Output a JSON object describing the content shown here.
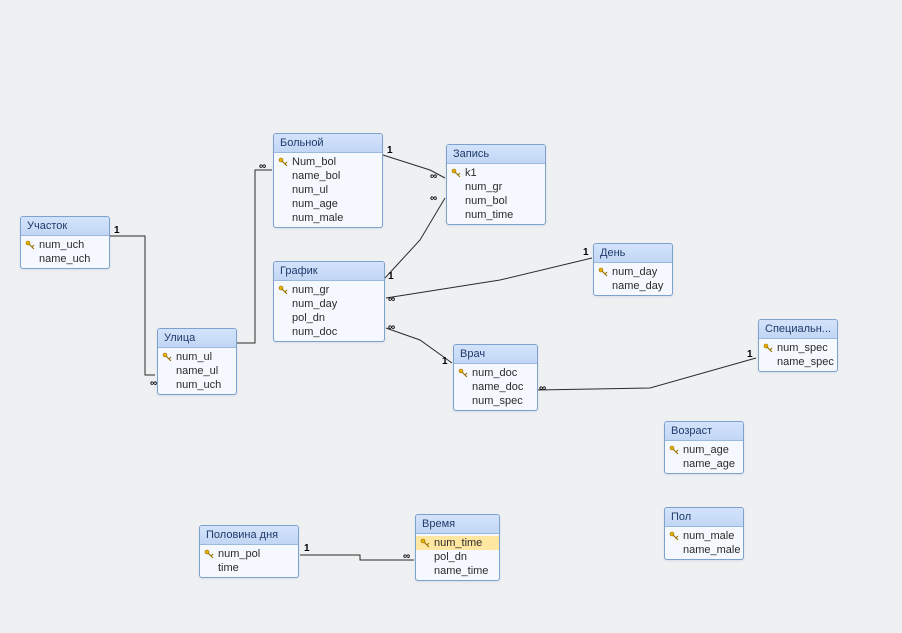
{
  "tables": {
    "uchastok": {
      "title": "Участок",
      "fields": [
        {
          "name": "num_uch",
          "pk": true
        },
        {
          "name": "name_uch",
          "pk": false
        }
      ]
    },
    "ulitsa": {
      "title": "Улица",
      "fields": [
        {
          "name": "num_ul",
          "pk": true
        },
        {
          "name": "name_ul",
          "pk": false
        },
        {
          "name": "num_uch",
          "pk": false
        }
      ]
    },
    "bolnoy": {
      "title": "Больной",
      "fields": [
        {
          "name": "Num_bol",
          "pk": true
        },
        {
          "name": "name_bol",
          "pk": false
        },
        {
          "name": "num_ul",
          "pk": false
        },
        {
          "name": "num_age",
          "pk": false
        },
        {
          "name": "num_male",
          "pk": false
        }
      ]
    },
    "zapis": {
      "title": "Запись",
      "fields": [
        {
          "name": "k1",
          "pk": true
        },
        {
          "name": "num_gr",
          "pk": false
        },
        {
          "name": "num_bol",
          "pk": false
        },
        {
          "name": "num_time",
          "pk": false
        }
      ]
    },
    "grafik": {
      "title": "График",
      "fields": [
        {
          "name": "num_gr",
          "pk": true
        },
        {
          "name": "num_day",
          "pk": false
        },
        {
          "name": "pol_dn",
          "pk": false
        },
        {
          "name": "num_doc",
          "pk": false
        }
      ]
    },
    "den": {
      "title": "День",
      "fields": [
        {
          "name": "num_day",
          "pk": true
        },
        {
          "name": "name_day",
          "pk": false
        }
      ]
    },
    "vrach": {
      "title": "Врач",
      "fields": [
        {
          "name": "num_doc",
          "pk": true
        },
        {
          "name": "name_doc",
          "pk": false
        },
        {
          "name": "num_spec",
          "pk": false
        }
      ]
    },
    "spec": {
      "title": "Специальн...",
      "fields": [
        {
          "name": "num_spec",
          "pk": true
        },
        {
          "name": "name_spec",
          "pk": false
        }
      ]
    },
    "vozrast": {
      "title": "Возраст",
      "fields": [
        {
          "name": "num_age",
          "pk": true
        },
        {
          "name": "name_age",
          "pk": false
        }
      ]
    },
    "pol": {
      "title": "Пол",
      "fields": [
        {
          "name": "num_male",
          "pk": true
        },
        {
          "name": "name_male",
          "pk": false
        }
      ]
    },
    "polovina": {
      "title": "Половина дня",
      "fields": [
        {
          "name": "num_pol",
          "pk": true
        },
        {
          "name": "time",
          "pk": false
        }
      ]
    },
    "vremya": {
      "title": "Время",
      "fields": [
        {
          "name": "num_time",
          "pk": true,
          "highlight": true
        },
        {
          "name": "pol_dn",
          "pk": false
        },
        {
          "name": "name_time",
          "pk": false
        }
      ]
    }
  },
  "relations": [
    {
      "from": "uchastok",
      "to": "ulitsa",
      "fromCard": "1",
      "toCard": "∞"
    },
    {
      "from": "ulitsa",
      "to": "bolnoy",
      "fromCard": "1",
      "toCard": "∞"
    },
    {
      "from": "bolnoy",
      "to": "zapis",
      "fromCard": "1",
      "toCard": "∞"
    },
    {
      "from": "grafik",
      "to": "zapis",
      "fromCard": "1",
      "toCard": "∞"
    },
    {
      "from": "den",
      "to": "grafik",
      "fromCard": "1",
      "toCard": "∞"
    },
    {
      "from": "vrach",
      "to": "grafik",
      "fromCard": "1",
      "toCard": "∞"
    },
    {
      "from": "spec",
      "to": "vrach",
      "fromCard": "1",
      "toCard": "∞"
    },
    {
      "from": "polovina",
      "to": "vremya",
      "fromCard": "1",
      "toCard": "∞"
    }
  ],
  "labels": {
    "one": "1",
    "many": "∞"
  }
}
